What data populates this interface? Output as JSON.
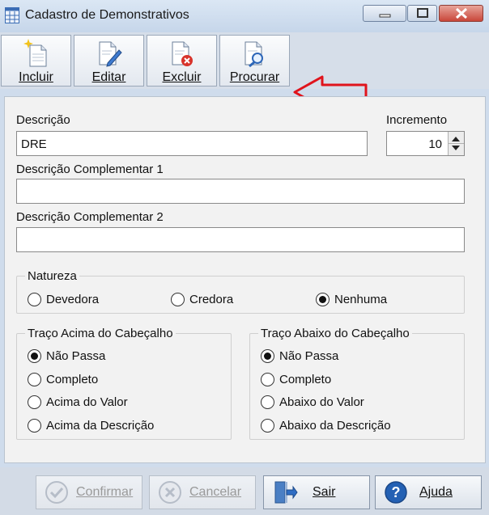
{
  "window": {
    "title": "Cadastro de Demonstrativos",
    "icon": "spreadsheet-app-icon",
    "controls": [
      "minimize-icon",
      "maximize-icon",
      "close-icon"
    ]
  },
  "toolbar": {
    "incluir": "Incluir",
    "editar": "Editar",
    "excluir": "Excluir",
    "procurar": "Procurar"
  },
  "form": {
    "descricao_label": "Descrição",
    "descricao_value": "DRE",
    "incremento_label": "Incremento",
    "incremento_value": "10",
    "comp1_label": "Descrição Complementar 1",
    "comp1_value": "",
    "comp2_label": "Descrição Complementar 2",
    "comp2_value": ""
  },
  "natureza": {
    "title": "Natureza",
    "options": [
      "Devedora",
      "Credora",
      "Nenhuma"
    ],
    "selected": "Nenhuma"
  },
  "traco_acima": {
    "title": "Traço Acima do Cabeçalho",
    "options": [
      "Não Passa",
      "Completo",
      "Acima do Valor",
      "Acima da Descrição"
    ],
    "selected": "Não Passa"
  },
  "traco_abaixo": {
    "title": "Traço Abaixo do Cabeçalho",
    "options": [
      "Não Passa",
      "Completo",
      "Abaixo do Valor",
      "Abaixo da Descrição"
    ],
    "selected": "Não Passa"
  },
  "buttons": {
    "confirmar": "Confirmar",
    "cancelar": "Cancelar",
    "sair": "Sair",
    "ajuda": "Ajuda"
  },
  "colors": {
    "annotation_arrow": "#e0141c",
    "help_icon": "#2461b4"
  }
}
